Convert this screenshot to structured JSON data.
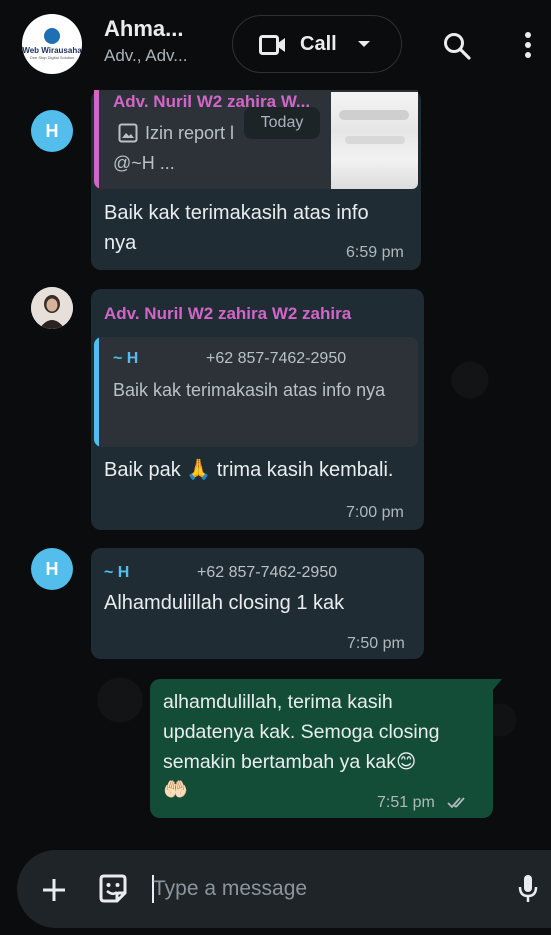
{
  "header": {
    "logo_text": "Web Wirausaha",
    "logo_sub": "One Stop Digital Solution",
    "title": "Ahma...",
    "subtitle": "Adv., Adv...",
    "call_label": "Call",
    "icons": {
      "video": "video-camera-icon",
      "dropdown": "chevron-down-icon",
      "search": "search-icon",
      "menu": "more-vertical-icon"
    }
  },
  "today_label": "Today",
  "messages": [
    {
      "avatar": "H",
      "reply_sender": "Adv. Nuril W2 zahira W...",
      "reply_text_line1": "Izin report l",
      "reply_text_line2": "@~H ...",
      "text": "Baik kak terimakasih atas info nya",
      "time": "6:59 pm"
    },
    {
      "sender": "Adv. Nuril W2 zahira W2 zahira",
      "quote_name": "~ H",
      "quote_phone": "+62 857-7462-2950",
      "quote_text": "Baik kak terimakasih atas info nya",
      "text_before": "Baik pak",
      "emoji": "🙏",
      "text_after": "trima kasih kembali.",
      "time": "7:00 pm"
    },
    {
      "avatar": "H",
      "sender_name": "~ H",
      "sender_phone": "+62 857-7462-2950",
      "text": "Alhamdulillah closing 1 kak",
      "time": "7:50 pm"
    },
    {
      "text": "alhamdulillah, terima kasih updatenya kak. Semoga closing semakin bertambah ya kak😊",
      "emoji_line": "🤲🏻",
      "time": "7:51 pm",
      "status": "read-double-check-icon"
    }
  ],
  "composer": {
    "placeholder": "Type a message",
    "icons": {
      "attach": "plus-icon",
      "sticker": "sticker-icon",
      "voice": "microphone-icon"
    }
  },
  "colors": {
    "background": "#0b0c0d",
    "incoming_bubble": "#202c33",
    "outgoing_bubble": "#144d37",
    "sender_pink": "#d166c8",
    "quote_blue": "#53bdeb"
  }
}
